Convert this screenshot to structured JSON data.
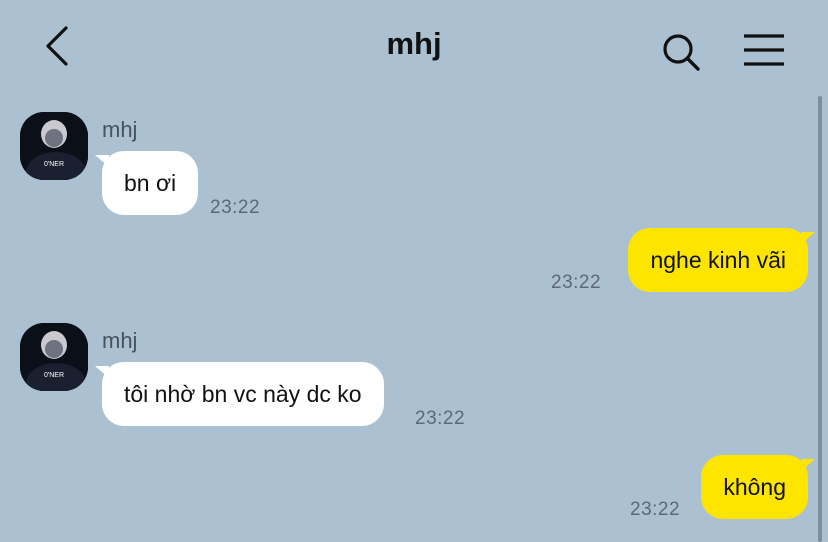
{
  "header": {
    "title": "mhj",
    "back_icon": "chevron-left-icon",
    "search_icon": "search-icon",
    "menu_icon": "hamburger-menu-icon"
  },
  "avatar_text": "0'NER",
  "messages": [
    {
      "direction": "in",
      "sender": "mhj",
      "text": "bn ơi",
      "time": "23:22"
    },
    {
      "direction": "out",
      "text": "nghe kinh vãi",
      "time": "23:22"
    },
    {
      "direction": "in",
      "sender": "mhj",
      "text": "tôi nhờ bn vc này dc ko",
      "time": "23:22"
    },
    {
      "direction": "out",
      "text": "không",
      "time": "23:22"
    }
  ],
  "colors": {
    "background": "#abc1d1",
    "incoming_bubble": "#ffffff",
    "outgoing_bubble": "#fee500"
  }
}
